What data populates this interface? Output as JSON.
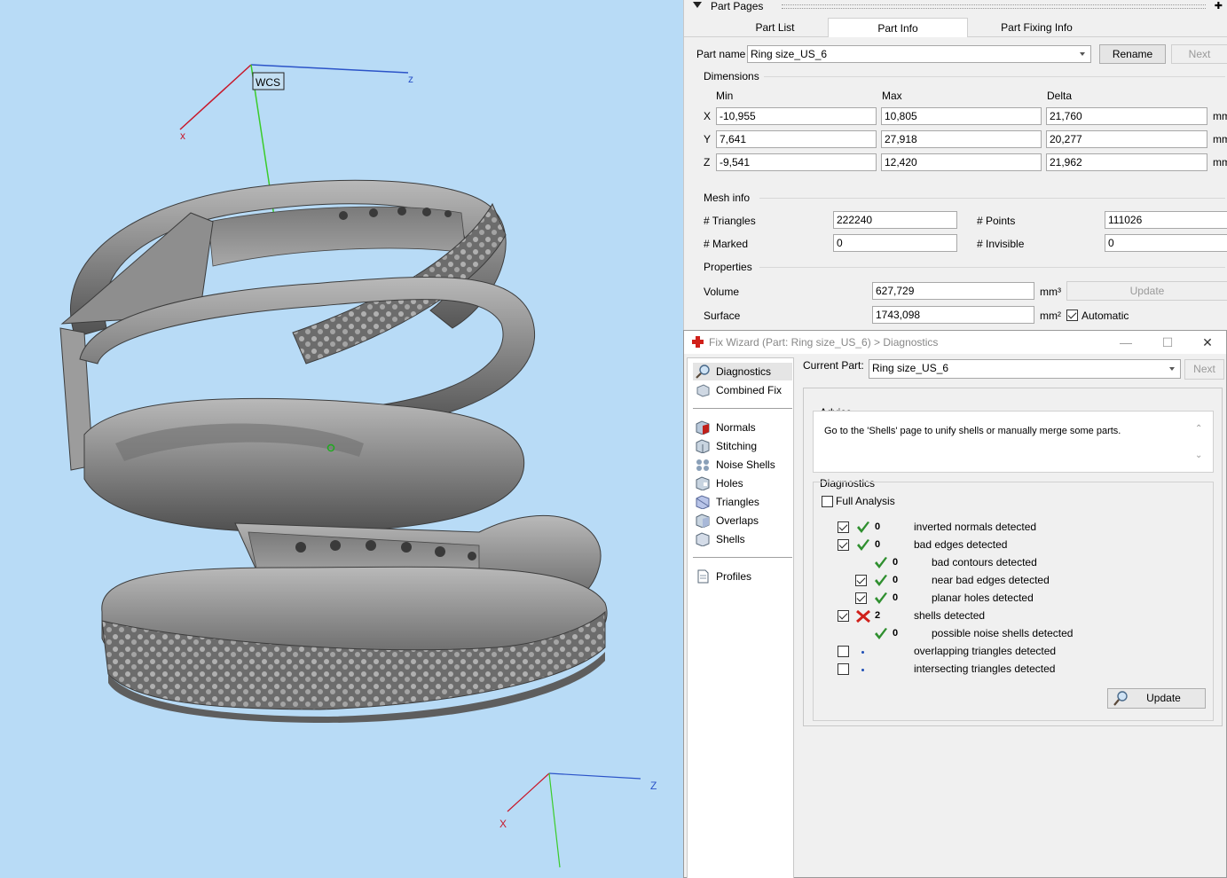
{
  "viewport": {
    "wcs_label": "WCS",
    "top_axes": {
      "x": "x",
      "z": "z"
    },
    "bottom_axes": {
      "x": "X",
      "z": "Z"
    }
  },
  "part_pages": {
    "title": "Part Pages",
    "tabs": [
      "Part List",
      "Part Info",
      "Part Fixing Info"
    ],
    "active_tab": "Part Info",
    "part_name_label": "Part name",
    "part_name": "Ring size_US_6",
    "rename_label": "Rename",
    "next_label": "Next",
    "dimensions": {
      "title": "Dimensions",
      "col_min": "Min",
      "col_max": "Max",
      "col_delta": "Delta",
      "unit": "mm",
      "rows": [
        {
          "axis": "X",
          "min": "-10,955",
          "max": "10,805",
          "delta": "21,760"
        },
        {
          "axis": "Y",
          "min": "7,641",
          "max": "27,918",
          "delta": "20,277"
        },
        {
          "axis": "Z",
          "min": "-9,541",
          "max": "12,420",
          "delta": "21,962"
        }
      ]
    },
    "mesh_info": {
      "title": "Mesh info",
      "triangles_label": "# Triangles",
      "triangles": "222240",
      "points_label": "# Points",
      "points": "111026",
      "marked_label": "# Marked",
      "marked": "0",
      "invisible_label": "# Invisible",
      "invisible": "0"
    },
    "properties": {
      "title": "Properties",
      "volume_label": "Volume",
      "volume": "627,729",
      "volume_unit": "mm³",
      "update_label": "Update",
      "surface_label": "Surface",
      "surface": "1743,098",
      "surface_unit": "mm²",
      "automatic_label": "Automatic",
      "automatic_checked": true
    }
  },
  "fix_wizard": {
    "title": "Fix Wizard (Part: Ring size_US_6) > Diagnostics",
    "nav": {
      "items_top": [
        "Diagnostics",
        "Combined Fix"
      ],
      "items_mid": [
        "Normals",
        "Stitching",
        "Noise Shells",
        "Holes",
        "Triangles",
        "Overlaps",
        "Shells"
      ],
      "items_bottom": [
        "Profiles"
      ],
      "selected": "Diagnostics"
    },
    "current_part_label": "Current Part:",
    "current_part": "Ring size_US_6",
    "next_label": "Next",
    "advice": {
      "title": "Advice",
      "text": "Go to the 'Shells' page to unify shells or manually merge some parts."
    },
    "diagnostics": {
      "title": "Diagnostics",
      "full_analysis_label": "Full Analysis",
      "full_analysis_checked": false,
      "rows": [
        {
          "check": "checked",
          "status": "ok",
          "count": "0",
          "text": "inverted normals detected",
          "indent": 0
        },
        {
          "check": "checked",
          "status": "ok",
          "count": "0",
          "text": "bad edges detected",
          "indent": 0
        },
        {
          "check": "none",
          "status": "ok",
          "count": "0",
          "text": "bad contours detected",
          "indent": 1
        },
        {
          "check": "checked",
          "status": "ok",
          "count": "0",
          "text": "near bad edges detected",
          "indent": 1
        },
        {
          "check": "checked",
          "status": "ok",
          "count": "0",
          "text": "planar holes detected",
          "indent": 1
        },
        {
          "check": "checked",
          "status": "error",
          "count": "2",
          "text": "shells detected",
          "indent": 0
        },
        {
          "check": "none",
          "status": "ok",
          "count": "0",
          "text": "possible noise shells detected",
          "indent": 1
        },
        {
          "check": "unchecked",
          "status": "dot",
          "count": "",
          "text": "overlapping triangles detected",
          "indent": 0
        },
        {
          "check": "unchecked",
          "status": "dot",
          "count": "",
          "text": "intersecting triangles detected",
          "indent": 0
        }
      ],
      "update_label": "Update"
    }
  }
}
